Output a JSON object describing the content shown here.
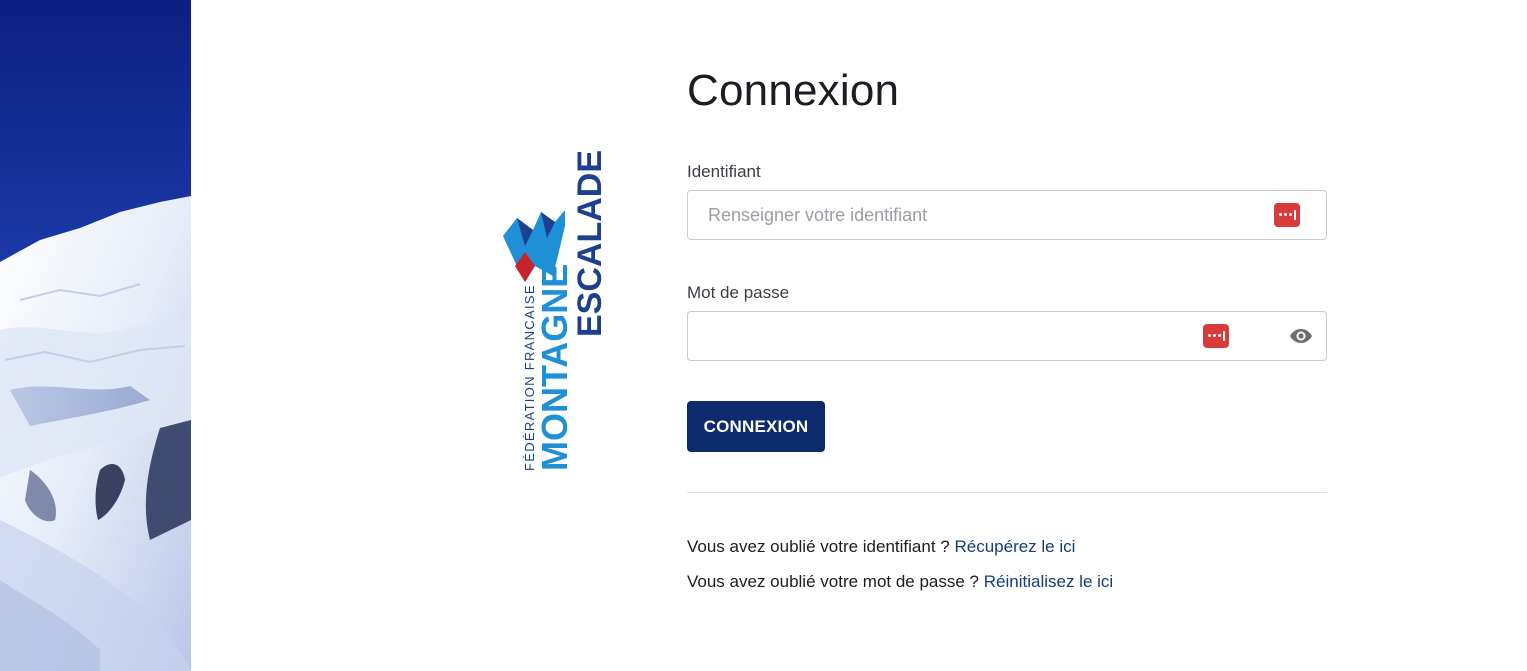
{
  "form": {
    "title": "Connexion",
    "username": {
      "label": "Identifiant",
      "placeholder": "Renseigner votre identifiant",
      "value": ""
    },
    "password": {
      "label": "Mot de passe",
      "placeholder": "",
      "value": ""
    },
    "submit_label": "CONNEXION"
  },
  "help": {
    "forgot_username_text": "Vous avez oublié votre identifiant ?",
    "forgot_username_link": "Récupérez le ici",
    "forgot_password_text": "Vous avez oublié votre mot de passe ?",
    "forgot_password_link": "Réinitialisez le ici"
  },
  "logo": {
    "line1": "FÉDÉRATION FRANCAISE",
    "line2": "MONTAGNE",
    "line3": "ESCALADE"
  },
  "icons": {
    "password_manager": "password-manager-icon",
    "show_password": "eye-icon"
  },
  "colors": {
    "primary_button": "#0d2a6c",
    "link": "#123e82",
    "logo_dark_blue": "#1d3f8f",
    "logo_light_blue": "#1f8fd6",
    "logo_red": "#c8232c",
    "password_manager_red": "#d93a3a"
  }
}
